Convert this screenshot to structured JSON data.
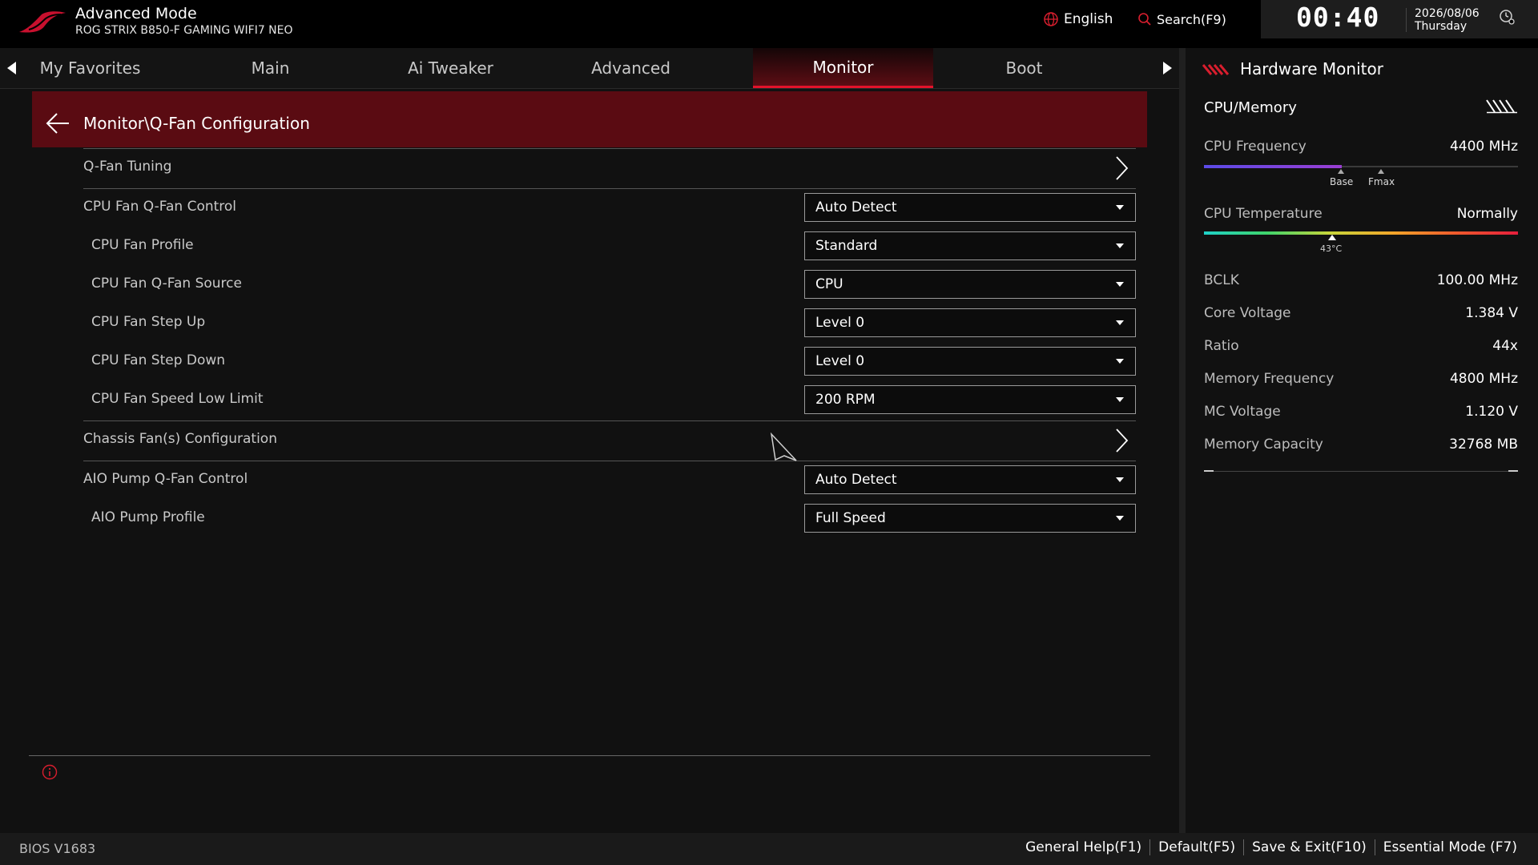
{
  "header": {
    "mode_title": "Advanced Mode",
    "board_name": "ROG STRIX B850-F GAMING WIFI7 NEO",
    "language": "English",
    "search": "Search(F9)",
    "time": "00:40",
    "date": "2026/08/06",
    "weekday": "Thursday"
  },
  "tabs": [
    {
      "label": "My Favorites",
      "active": false
    },
    {
      "label": "Main",
      "active": false
    },
    {
      "label": "Ai Tweaker",
      "active": false
    },
    {
      "label": "Advanced",
      "active": false
    },
    {
      "label": "Monitor",
      "active": true
    },
    {
      "label": "Boot",
      "active": false
    }
  ],
  "page": {
    "path": "Monitor\\Q-Fan Configuration",
    "items": [
      {
        "label": "Q-Fan Tuning",
        "type": "submenu"
      },
      {
        "label": "CPU Fan Q-Fan Control",
        "type": "dropdown",
        "value": "Auto Detect"
      },
      {
        "label": "CPU Fan Profile",
        "type": "dropdown",
        "value": "Standard"
      },
      {
        "label": "CPU Fan Q-Fan Source",
        "type": "dropdown",
        "value": "CPU"
      },
      {
        "label": "CPU Fan Step Up",
        "type": "dropdown",
        "value": "Level 0"
      },
      {
        "label": "CPU Fan Step Down",
        "type": "dropdown",
        "value": "Level 0"
      },
      {
        "label": "CPU Fan Speed Low Limit",
        "type": "dropdown",
        "value": "200 RPM"
      },
      {
        "label": "Chassis Fan(s) Configuration",
        "type": "submenu"
      },
      {
        "label": "AIO Pump Q-Fan Control",
        "type": "dropdown",
        "value": "Auto Detect"
      },
      {
        "label": "AIO Pump Profile",
        "type": "dropdown",
        "value": "Full Speed"
      }
    ]
  },
  "hardware_monitor": {
    "title": "Hardware Monitor",
    "section": "CPU/Memory",
    "cpu_frequency": {
      "label": "CPU Frequency",
      "value": "4400 MHz",
      "bar_fraction": 0.44,
      "base_label": "Base",
      "fmax_label": "Fmax"
    },
    "cpu_temperature": {
      "label": "CPU Temperature",
      "value": "Normally",
      "marker_label": "43°C",
      "marker_fraction": 0.41
    },
    "rows": [
      {
        "label": "BCLK",
        "value": "100.00 MHz"
      },
      {
        "label": "Core Voltage",
        "value": "1.384 V"
      },
      {
        "label": "Ratio",
        "value": "44x"
      },
      {
        "label": "Memory Frequency",
        "value": "4800 MHz"
      },
      {
        "label": "MC Voltage",
        "value": "1.120 V"
      },
      {
        "label": "Memory Capacity",
        "value": "32768 MB"
      }
    ]
  },
  "footer": {
    "bios_version": "BIOS V1683",
    "actions": [
      "General Help(F1)",
      "Default(F5)",
      "Save & Exit(F10)",
      "Essential Mode (F7)"
    ]
  },
  "colors": {
    "accent": "#e3132b",
    "banner": "#5a0b12",
    "background": "#111111"
  }
}
